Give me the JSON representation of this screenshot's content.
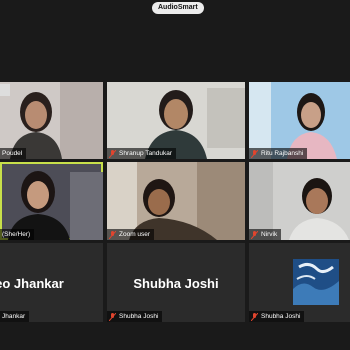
{
  "app": {
    "title": "AudioSmart"
  },
  "participants": [
    {
      "name": "Poudel"
    },
    {
      "name": "Shranup Tandukar"
    },
    {
      "name": "Ritu Rajbanshi"
    },
    {
      "name": "(She/Her)"
    },
    {
      "name": "Zoom user"
    },
    {
      "name": "Nirvik"
    },
    {
      "name": "Jhankar",
      "display_name": "Leo Jhankar"
    },
    {
      "name": "Shubha Joshi",
      "display_name": "Shubha Joshi"
    },
    {
      "name": "Shubha Joshi"
    }
  ],
  "icons": {
    "muted_mic": "mic-off-icon",
    "qr": "qr-code-icon"
  },
  "colors": {
    "active_speaker": "#c8e04a",
    "muted": "#e0452e",
    "tile_bg": "#2b2b2b"
  }
}
